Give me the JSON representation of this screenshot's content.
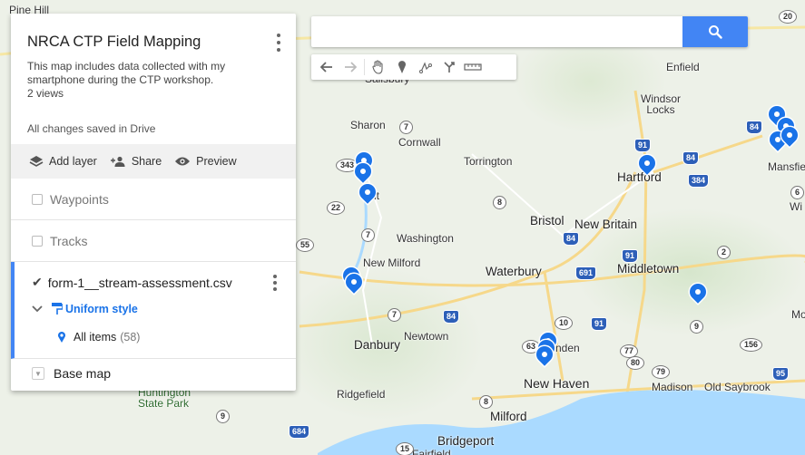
{
  "search": {
    "placeholder": "",
    "value": ""
  },
  "toolbar": {
    "tools": [
      "undo-icon",
      "redo-icon",
      "hand-icon",
      "marker-icon",
      "draw-line-icon",
      "directions-icon",
      "ruler-icon"
    ]
  },
  "panel": {
    "title": "NRCA CTP Field Mapping",
    "description": "This map includes data collected with my smartphone during the CTP workshop.",
    "views": "2 views",
    "save_status": "All changes saved in Drive",
    "actions": {
      "add_layer": "Add layer",
      "share": "Share",
      "preview": "Preview"
    },
    "layers": {
      "waypoints": "Waypoints",
      "tracks": "Tracks",
      "csv_name": "form-1__stream-assessment.csv",
      "style": "Uniform style",
      "all_items": "All items",
      "all_items_count": "(58)",
      "base_map": "Base map"
    }
  },
  "map_labels": {
    "pine_hill": "Pine Hill",
    "salisbury": "Salisbury",
    "sharon": "Sharon",
    "cornwall": "Cornwall",
    "torrington": "Torrington",
    "enfield": "Enfield",
    "windsor_locks": "Windsor\nLocks",
    "hartford": "Hartford",
    "mansfield": "Mansfie",
    "bristol": "Bristol",
    "new_britain": "New Britain",
    "washington": "Washington",
    "new_milford": "New Milford",
    "waterbury": "Waterbury",
    "middletown": "Middletown",
    "danbury": "Danbury",
    "newtown": "Newtown",
    "hamden": "nden",
    "new_haven": "New Haven",
    "madison": "Madison",
    "old_saybrook": "Old Saybrook",
    "ridgefield": "Ridgefield",
    "milford": "Milford",
    "bridgeport": "Bridgeport",
    "fairfield": "Fairfield",
    "huntington": "Huntington\nState Park",
    "kent": "nt",
    "wi": "Wi",
    "mo": "Mo"
  },
  "shields": {
    "s20": "20",
    "s7": "7",
    "s343": "343",
    "s22": "22",
    "s8": "8",
    "s7b": "7",
    "s55": "55",
    "i91a": "91",
    "i84a": "84",
    "i384": "384",
    "i84b": "84",
    "i84c": "84",
    "i91b": "91",
    "i691": "691",
    "s2": "2",
    "s7c": "7",
    "i84d": "84",
    "s10": "10",
    "i91c": "91",
    "s63": "63",
    "s77": "77",
    "s80": "80",
    "s79": "79",
    "s9": "9",
    "s156": "156",
    "i95": "95",
    "s8b": "8",
    "s9b": "9",
    "i684": "684",
    "s15": "15",
    "s6": "6"
  },
  "colors": {
    "accent": "#4285f4",
    "pin": "#1a73e8"
  }
}
